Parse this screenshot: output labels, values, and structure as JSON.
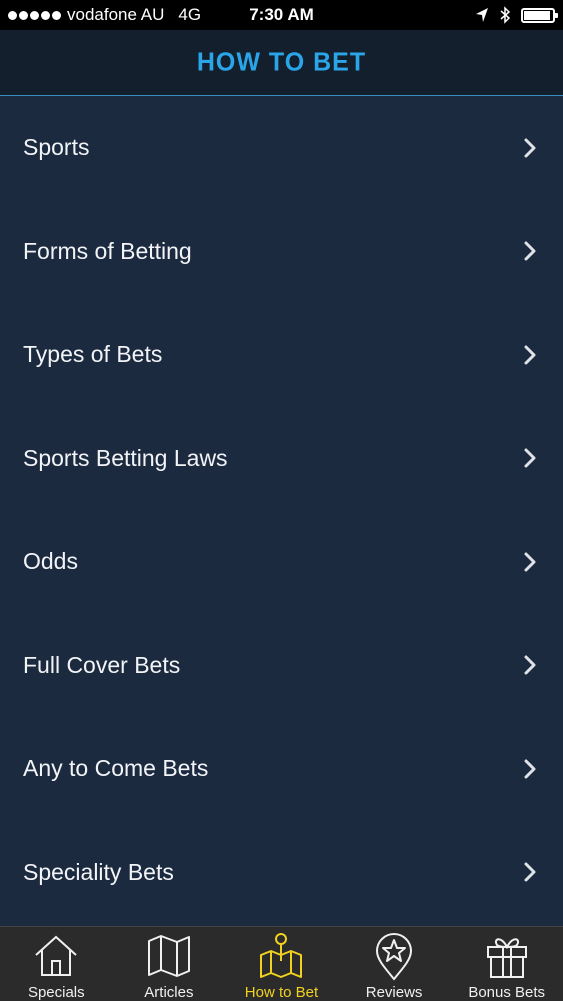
{
  "status_bar": {
    "carrier": "vodafone AU",
    "network": "4G",
    "time": "7:30 AM",
    "signal_bars": 5
  },
  "header": {
    "title": "HOW TO BET"
  },
  "menu": {
    "items": [
      {
        "label": "Sports"
      },
      {
        "label": "Forms of Betting"
      },
      {
        "label": "Types of Bets"
      },
      {
        "label": "Sports Betting Laws"
      },
      {
        "label": "Odds"
      },
      {
        "label": "Full Cover Bets"
      },
      {
        "label": "Any to Come Bets"
      },
      {
        "label": "Speciality Bets"
      }
    ]
  },
  "tab_bar": {
    "tabs": [
      {
        "label": "Specials",
        "icon": "house-icon",
        "active": false
      },
      {
        "label": "Articles",
        "icon": "map-icon",
        "active": false
      },
      {
        "label": "How to Bet",
        "icon": "map-pin-icon",
        "active": true
      },
      {
        "label": "Reviews",
        "icon": "star-pin-icon",
        "active": false
      },
      {
        "label": "Bonus Bets",
        "icon": "gift-icon",
        "active": false
      }
    ]
  },
  "colors": {
    "background": "#1b2a3f",
    "header_background": "#141f2e",
    "title": "#2aa6e8",
    "active_tab": "#f2d21e",
    "tab_bar": "#2b2b2b"
  }
}
